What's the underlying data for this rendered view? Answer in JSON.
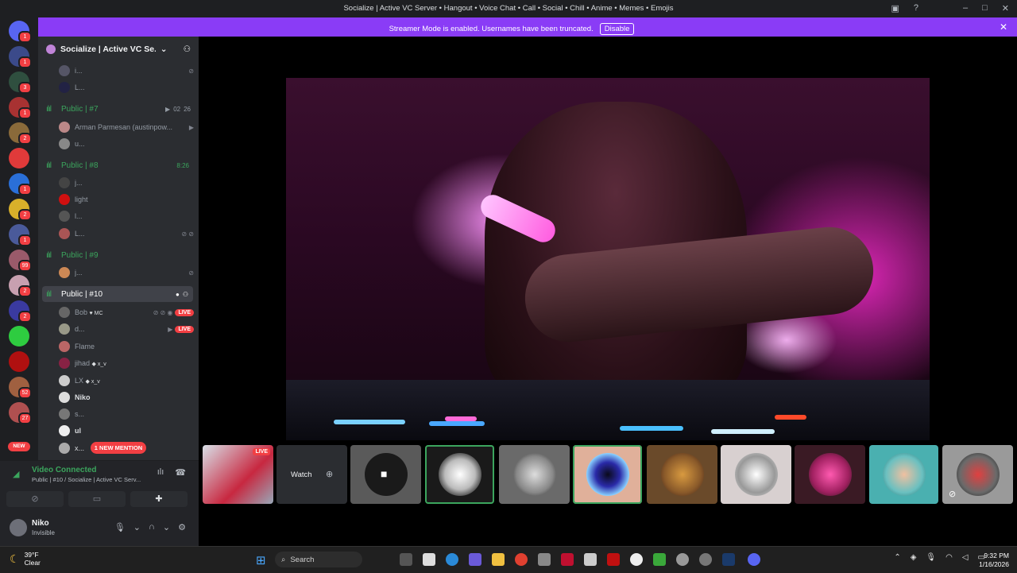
{
  "window": {
    "title": "Socialize | Active VC Server • Hangout • Voice Chat • Call • Social • Chill • Anime • Memes • Emojis"
  },
  "banner": {
    "message": "Streamer Mode is enabled. Usernames have been truncated.",
    "disable_label": "Disable"
  },
  "rail": {
    "new_label": "NEW",
    "badges": [
      "1",
      "1",
      "3",
      "1",
      "2",
      "1",
      "2",
      "1",
      "4",
      "99",
      "2",
      "2",
      "2",
      "52",
      "27"
    ]
  },
  "sidebar": {
    "server_name": "Socialize | Active VC Se...",
    "channels": [
      {
        "name": "Public | #7",
        "meta": "02",
        "meta2": "26",
        "users": [
          "Arman Parmesan (austinpow...",
          "u..."
        ]
      },
      {
        "name": "Public | #8",
        "timer": "8:26",
        "users": [
          "j...",
          "light",
          "l...",
          "L..."
        ]
      },
      {
        "name": "Public | #9",
        "users": [
          "j..."
        ]
      },
      {
        "name": "Public | #10",
        "users": [
          "Bob",
          "d...",
          "Flame",
          "jihad",
          "LX",
          "Niko",
          "s...",
          "ul",
          "x..."
        ]
      }
    ],
    "top_users": [
      "i...",
      "L..."
    ],
    "bob_tag": "MC",
    "jihad_tag": "x_v",
    "lx_tag": "x_v",
    "live_label": "LIVE",
    "mention_label": "1 NEW MENTION"
  },
  "voice": {
    "title": "Video Connected",
    "subtitle": "Public | #10 / Socialize | Active VC Serv..."
  },
  "user_panel": {
    "name": "Niko",
    "status": "Invisible"
  },
  "tiles": {
    "live_label": "LIVE",
    "watch_label": "Watch"
  },
  "taskbar": {
    "temp": "39°F",
    "condition": "Clear",
    "search": "Search",
    "time": "9:32 PM",
    "date": "1/16/2026"
  },
  "colors": {
    "accent": "#8a3cf6",
    "voice_green": "#3ba55d",
    "live_red": "#f23f43"
  }
}
